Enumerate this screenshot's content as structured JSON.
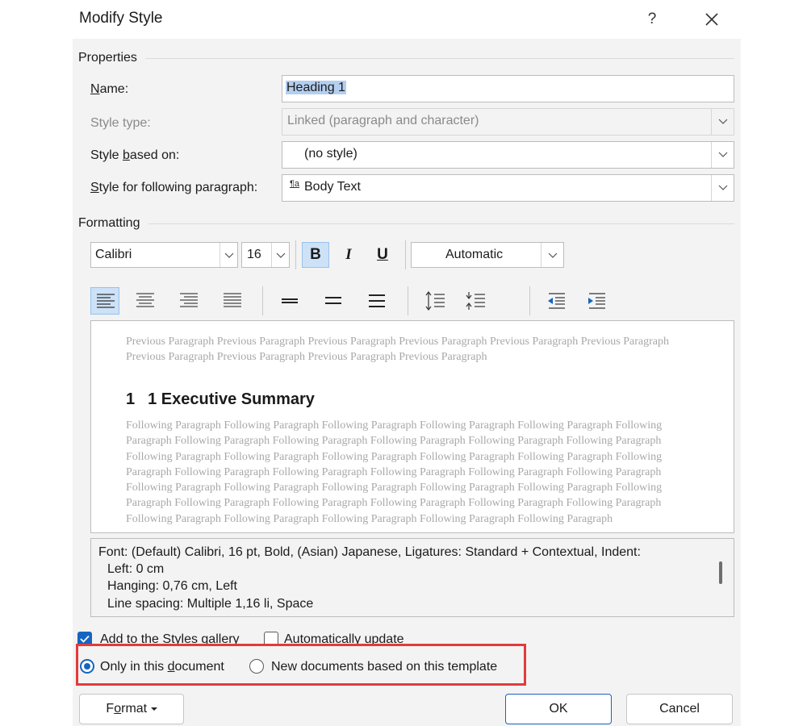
{
  "window": {
    "title": "Modify Style",
    "help_label": "?"
  },
  "properties": {
    "section_label": "Properties",
    "name": {
      "label_prefix": "",
      "label_accel": "N",
      "label_rest": "ame:",
      "value": "Heading 1"
    },
    "style_type": {
      "label": "Style type:",
      "value": "Linked (paragraph and character)"
    },
    "style_based_on": {
      "label_prefix": "Style ",
      "label_accel": "b",
      "label_rest": "ased on:",
      "value": "(no style)"
    },
    "style_following": {
      "label_prefix": "",
      "label_accel": "S",
      "label_rest": "tyle for following paragraph:",
      "icon_text": "¶a",
      "value": "Body Text"
    }
  },
  "formatting": {
    "section_label": "Formatting",
    "font": "Calibri",
    "size": "16",
    "bold_label": "B",
    "italic_label": "I",
    "underline_label": "U",
    "color": "Automatic",
    "active_alignment": "align-left"
  },
  "preview": {
    "previous_text": "Previous Paragraph Previous Paragraph Previous Paragraph Previous Paragraph Previous Paragraph Previous Paragraph Previous Paragraph Previous Paragraph Previous Paragraph Previous Paragraph",
    "heading_number": "1",
    "heading_text": "1 Executive Summary",
    "following_text": "Following Paragraph Following Paragraph Following Paragraph Following Paragraph Following Paragraph Following Paragraph Following Paragraph Following Paragraph Following Paragraph Following Paragraph Following Paragraph Following Paragraph Following Paragraph Following Paragraph Following Paragraph Following Paragraph Following Paragraph Following Paragraph Following Paragraph Following Paragraph Following Paragraph Following Paragraph Following Paragraph Following Paragraph Following Paragraph Following Paragraph Following Paragraph Following Paragraph Following Paragraph Following Paragraph Following Paragraph Following Paragraph Following Paragraph Following Paragraph Following Paragraph Following Paragraph Following Paragraph Following Paragraph"
  },
  "description": {
    "line1": "Font: (Default) Calibri, 16 pt, Bold, (Asian) Japanese, Ligatures: Standard + Contextual, Indent:",
    "line2": "Left:  0 cm",
    "line3": "Hanging:  0,76 cm, Left",
    "line4": "Line spacing:  Multiple 1,16 li, Space"
  },
  "options": {
    "add_to_gallery": {
      "label": "Add to the Styles gallery",
      "checked": true
    },
    "auto_update": {
      "label": "Automatically update",
      "checked": false
    },
    "only_this_doc": {
      "label_prefix": "Only in this ",
      "label_accel": "d",
      "label_rest": "ocument",
      "selected": true
    },
    "new_docs": {
      "label": "New documents based on this template",
      "selected": false
    }
  },
  "buttons": {
    "format_prefix": "F",
    "format_accel": "o",
    "format_rest": "rmat",
    "ok": "OK",
    "cancel": "Cancel"
  },
  "colors": {
    "accent": "#1565c0",
    "highlight_box": "#e23b3b",
    "selection": "#b3cff0"
  }
}
